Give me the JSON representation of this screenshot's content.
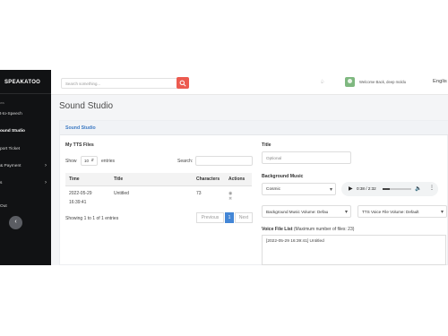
{
  "sidebar": {
    "brand": "SPEAKATOO",
    "faint_label": "ws",
    "items": [
      {
        "label": "t-to-Speech",
        "chevron": ""
      },
      {
        "label": "ound Studio",
        "chevron": ""
      },
      {
        "label": "port Ticket",
        "chevron": ""
      },
      {
        "label": "& Payment",
        "chevron": "›"
      },
      {
        "label": "s",
        "chevron": "›"
      },
      {
        "label": "Out",
        "chevron": ""
      }
    ],
    "collapse_icon": "‹"
  },
  "topbar": {
    "search_placeholder": "Search something...",
    "welcome": "Welcome Back, deep moldu",
    "language": "Englis"
  },
  "page": {
    "title": "Sound Studio"
  },
  "card": {
    "header": "Sound Studio"
  },
  "tts_files": {
    "heading": "My TTS Files",
    "show_label": "Show",
    "entries_count": "10",
    "entries_label": "entries",
    "search_label": "Search:",
    "columns": [
      "Time",
      "Title",
      "Characters",
      "Actions"
    ],
    "rows": [
      {
        "time_date": "2022-05-29",
        "time_clock": "16:39:41",
        "title": "Untitled",
        "characters": "73"
      }
    ],
    "info": "Showing 1 to 1 of 1 entries",
    "pagination": {
      "previous": "Previous",
      "current": "1",
      "next": "Next"
    }
  },
  "right_panel": {
    "title_label": "Title",
    "title_placeholder": "Optional",
    "bg_music_label": "Background Music",
    "bg_music_selected": "Cosmic",
    "audio_time": "0:38 / 2:32",
    "bg_volume_selected": "Background Music Volume: Defau",
    "tts_volume_selected": "TTS Voice File Volume: Default",
    "voice_list_label": "Voice File List",
    "voice_list_hint": "(Maximum number of files: 23)",
    "voice_list_item": "[2022-05-29 16:39:41] Untitled"
  },
  "colors": {
    "sidebar_bg": "#111214",
    "accent_red": "#ec5a4f",
    "accent_blue": "#4386d6",
    "header_text_blue": "#3e7bc4"
  }
}
